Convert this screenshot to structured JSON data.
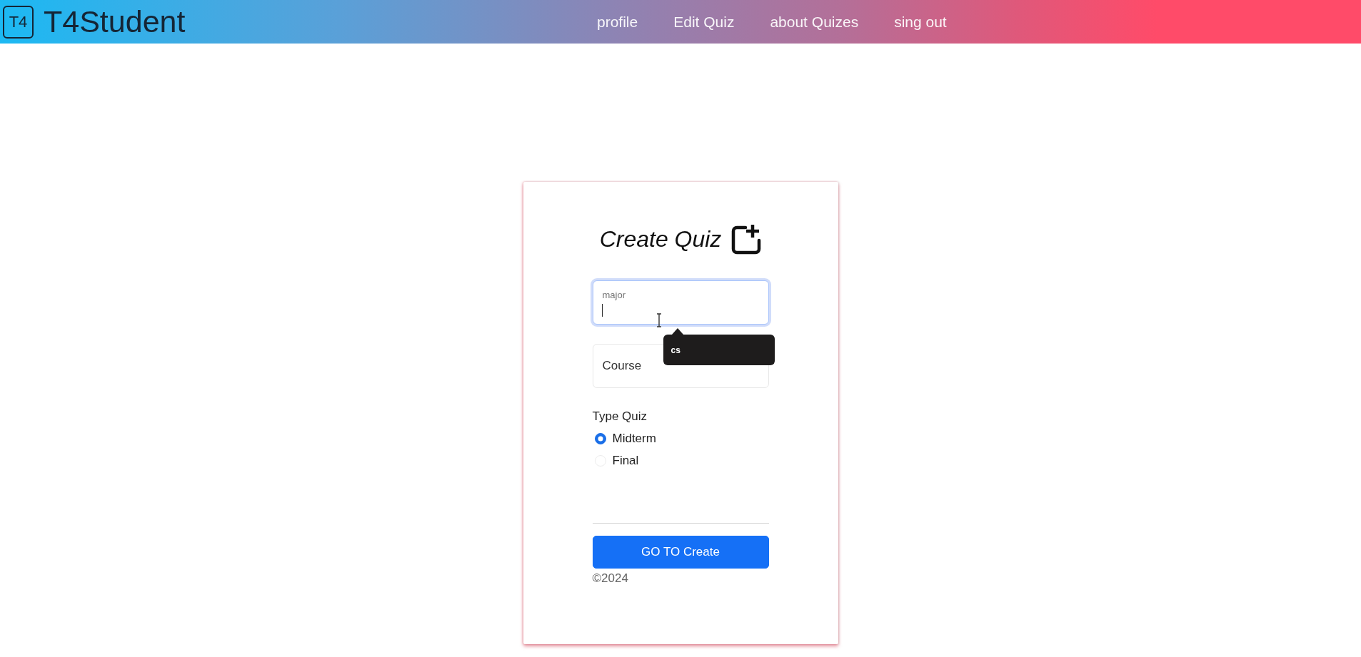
{
  "navbar": {
    "logo_text": "T4",
    "brand": "T4Student",
    "links": [
      "profile",
      "Edit Quiz",
      "about Quizes",
      "sing out"
    ]
  },
  "form": {
    "title": "Create Quiz",
    "fields": [
      {
        "label": "major",
        "focused": true,
        "suggestion": "cs"
      },
      {
        "label": "Course",
        "focused": false
      }
    ],
    "type_quiz": {
      "label": "Type Quiz",
      "options": [
        {
          "label": "Midterm",
          "selected": true
        },
        {
          "label": "Final",
          "selected": false
        }
      ]
    },
    "submit_button": "GO TO Create",
    "footer": "©2024"
  }
}
